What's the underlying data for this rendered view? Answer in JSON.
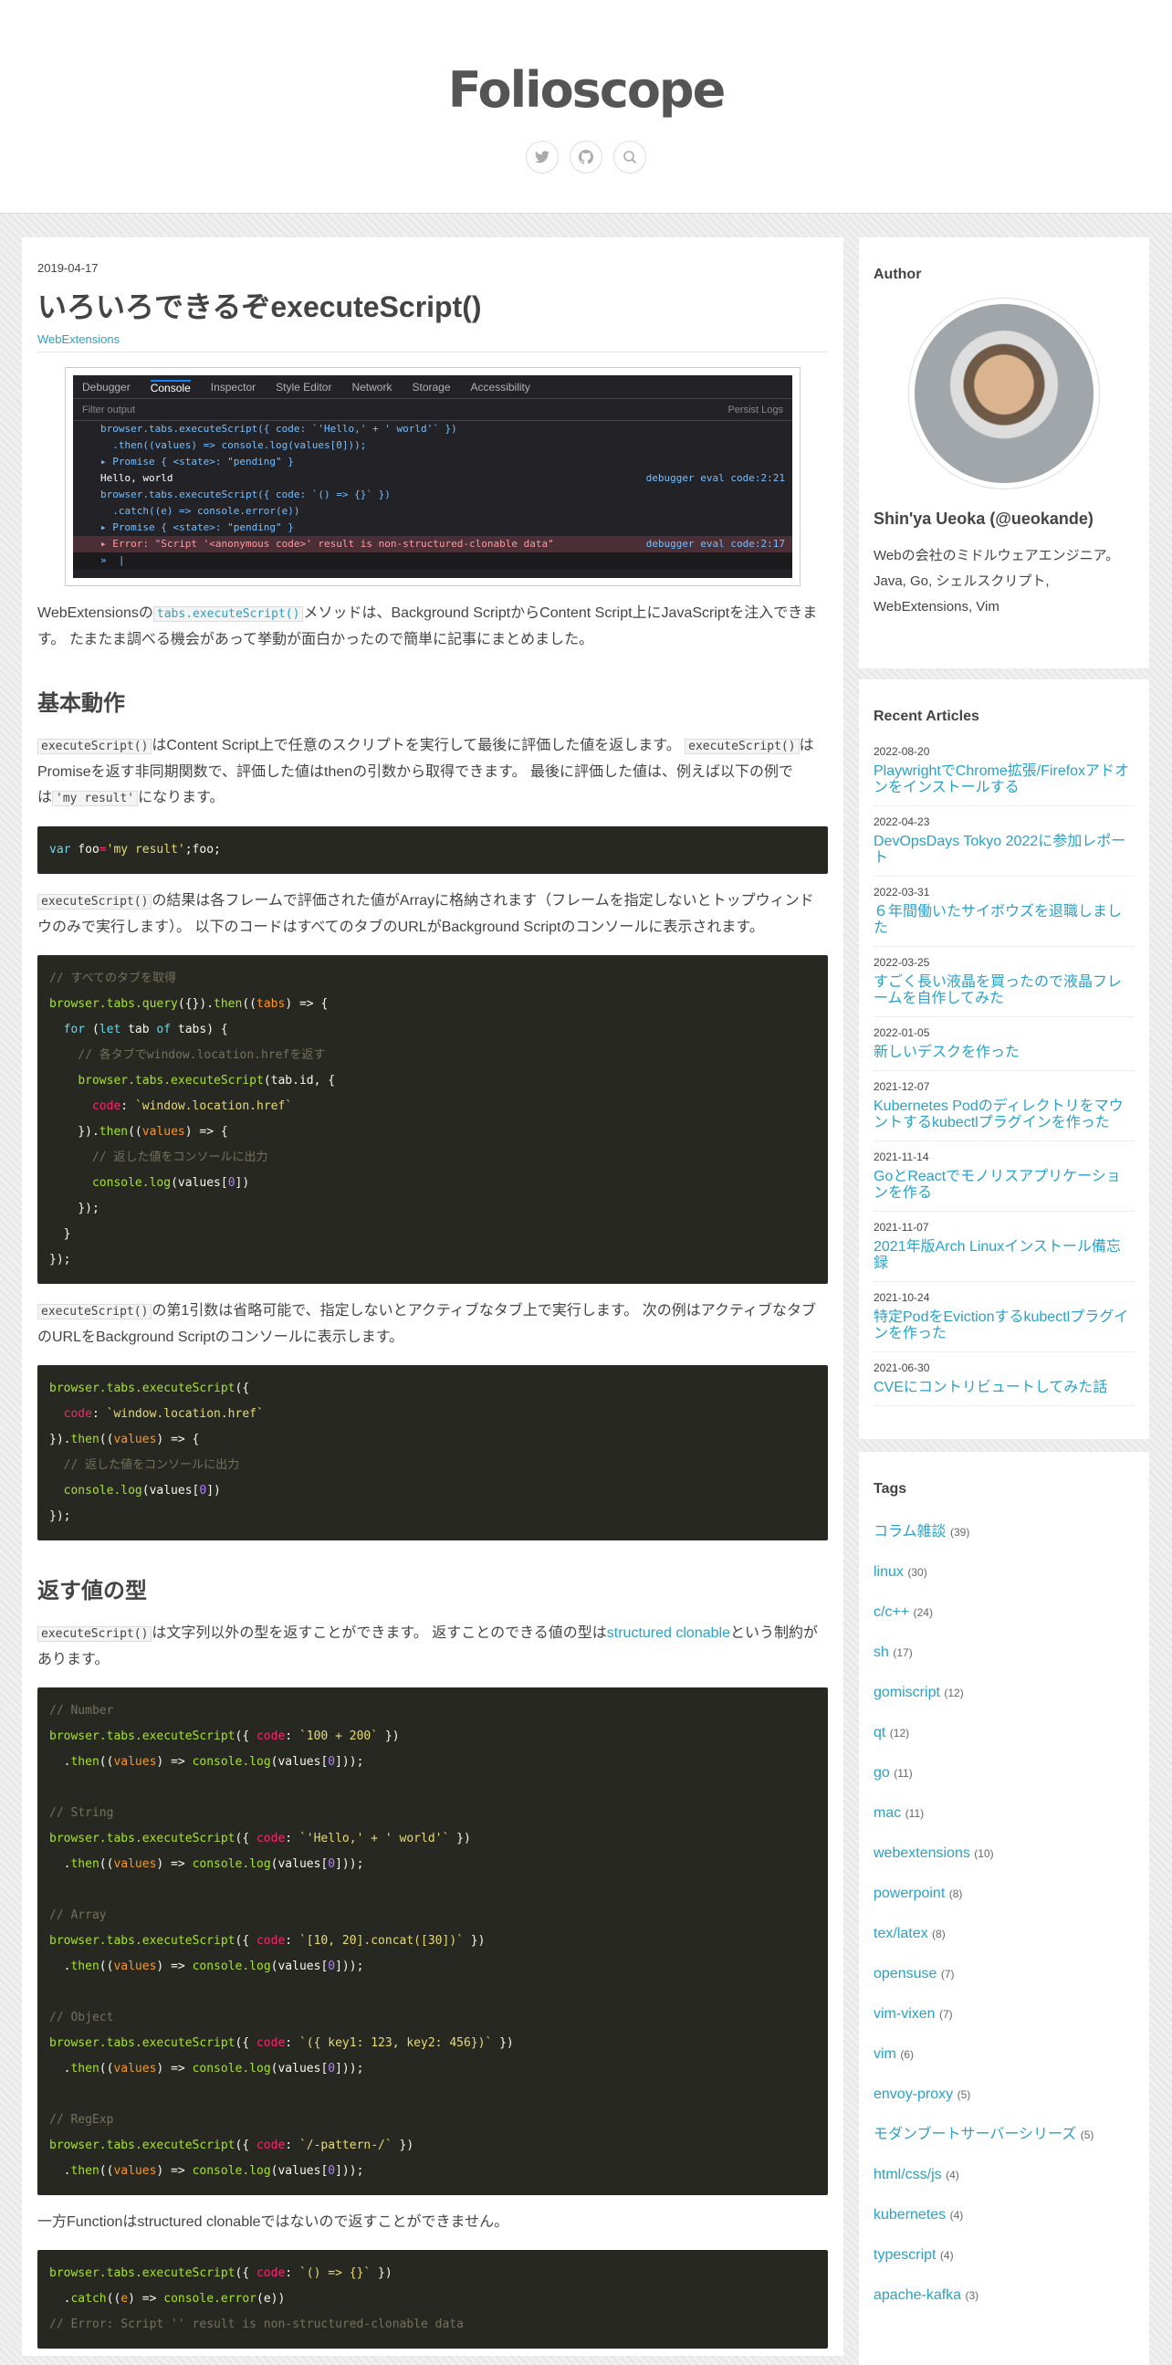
{
  "site": {
    "title": "Folioscope",
    "icons": [
      "twitter-icon",
      "github-icon",
      "search-icon"
    ]
  },
  "post": {
    "date": "2019-04-17",
    "title": "いろいろできるぞexecuteScript()",
    "category": "WebExtensions",
    "devtools": {
      "tabs": [
        "Debugger",
        "Console",
        "Inspector",
        "Style Editor",
        "Network",
        "Storage",
        "Accessibility"
      ],
      "filter_placeholder": "Filter output",
      "persist_logs": "Persist Logs",
      "lines": [
        {
          "text": "browser.tabs.executeScript({ code: `'Hello,' + ' world'` })",
          "ref": ""
        },
        {
          "text": "  .then((values) => console.log(values[0]));",
          "ref": ""
        },
        {
          "text": "▸ Promise { <state>: \"pending\" }",
          "ref": ""
        },
        {
          "text": "Hello, world",
          "ref": "debugger eval code:2:21"
        },
        {
          "text": "browser.tabs.executeScript({ code: `() => {}` })",
          "ref": ""
        },
        {
          "text": "  .catch((e) => console.error(e))",
          "ref": ""
        },
        {
          "text": "▸ Promise { <state>: \"pending\" }",
          "ref": ""
        },
        {
          "text": "▸ Error: \"Script '<anonymous code>' result is non-structured-clonable data\"",
          "ref": "debugger eval code:2:17"
        }
      ]
    },
    "p1_a": "WebExtensionsの",
    "p1_code": "tabs.executeScript()",
    "p1_b": "メソッドは、Background ScriptからContent Script上にJavaScriptを注入できます。 たまたま調べる機会があって挙動が面白かったので簡単に記事にまとめました。",
    "h_basic": "基本動作",
    "p2_code1": "executeScript()",
    "p2_a": "はContent Script上で任意のスクリプトを実行して最後に評価した値を返します。 ",
    "p2_code2": "executeScript()",
    "p2_b": "はPromiseを返す非同期関数で、評価した値はthenの引数から取得できます。 最後に評価した値は、例えば以下の例では",
    "p2_code3": "'my result'",
    "p2_c": "になります。",
    "p3_code": "executeScript()",
    "p3_a": "の結果は各フレームで評価された値がArrayに格納されます（フレームを指定しないとトップウィンドウのみで実行します）。 以下のコードはすべてのタブのURLがBackground Scriptのコンソールに表示されます。",
    "p4_code": "executeScript()",
    "p4_a": "の第1引数は省略可能で、指定しないとアクティブなタブ上で実行します。 次の例はアクティブなタブのURLをBackground Scriptのコンソールに表示します。",
    "h_return": "返す値の型",
    "p5_code": "executeScript()",
    "p5_a": "は文字列以外の型を返すことができます。 返すことのできる値の型は",
    "p5_link": "structured clonable",
    "p5_b": "という制約があります。",
    "p6": "一方Functionはstructured clonableではないので返すことができません。"
  },
  "sidebar": {
    "author_heading": "Author",
    "author_name": "Shin'ya Ueoka (@ueokande)",
    "author_desc": "Webの会社のミドルウェアエンジニア。Java, Go, シェルスクリプト, WebExtensions, Vim",
    "recent_heading": "Recent Articles",
    "articles": [
      {
        "date": "2022-08-20",
        "title": "PlaywrightでChrome拡張/Firefoxアドオンをインストールする"
      },
      {
        "date": "2022-04-23",
        "title": "DevOpsDays Tokyo 2022に参加レポート"
      },
      {
        "date": "2022-03-31",
        "title": "６年間働いたサイボウズを退職しました"
      },
      {
        "date": "2022-03-25",
        "title": "すごく長い液晶を買ったので液晶フレームを自作してみた"
      },
      {
        "date": "2022-01-05",
        "title": "新しいデスクを作った"
      },
      {
        "date": "2021-12-07",
        "title": "Kubernetes Podのディレクトリをマウントするkubectlプラグインを作った"
      },
      {
        "date": "2021-11-14",
        "title": "GoとReactでモノリスアプリケーションを作る"
      },
      {
        "date": "2021-11-07",
        "title": "2021年版Arch Linuxインストール備忘録"
      },
      {
        "date": "2021-10-24",
        "title": "特定PodをEvictionするkubectlプラグインを作った"
      },
      {
        "date": "2021-06-30",
        "title": "CVEにコントリビュートしてみた話"
      }
    ],
    "tags_heading": "Tags",
    "tags": [
      {
        "name": "コラム雑談",
        "count": "(39)"
      },
      {
        "name": "linux",
        "count": "(30)"
      },
      {
        "name": "c/c++",
        "count": "(24)"
      },
      {
        "name": "sh",
        "count": "(17)"
      },
      {
        "name": "gomiscript",
        "count": "(12)"
      },
      {
        "name": "qt",
        "count": "(12)"
      },
      {
        "name": "go",
        "count": "(11)"
      },
      {
        "name": "mac",
        "count": "(11)"
      },
      {
        "name": "webextensions",
        "count": "(10)"
      },
      {
        "name": "powerpoint",
        "count": "(8)"
      },
      {
        "name": "tex/latex",
        "count": "(8)"
      },
      {
        "name": "opensuse",
        "count": "(7)"
      },
      {
        "name": "vim-vixen",
        "count": "(7)"
      },
      {
        "name": "vim",
        "count": "(6)"
      },
      {
        "name": "envoy-proxy",
        "count": "(5)"
      },
      {
        "name": "モダンブートサーバーシリーズ",
        "count": "(5)"
      },
      {
        "name": "html/css/js",
        "count": "(4)"
      },
      {
        "name": "kubernetes",
        "count": "(4)"
      },
      {
        "name": "typescript",
        "count": "(4)"
      },
      {
        "name": "apache-kafka",
        "count": "(3)"
      }
    ]
  }
}
